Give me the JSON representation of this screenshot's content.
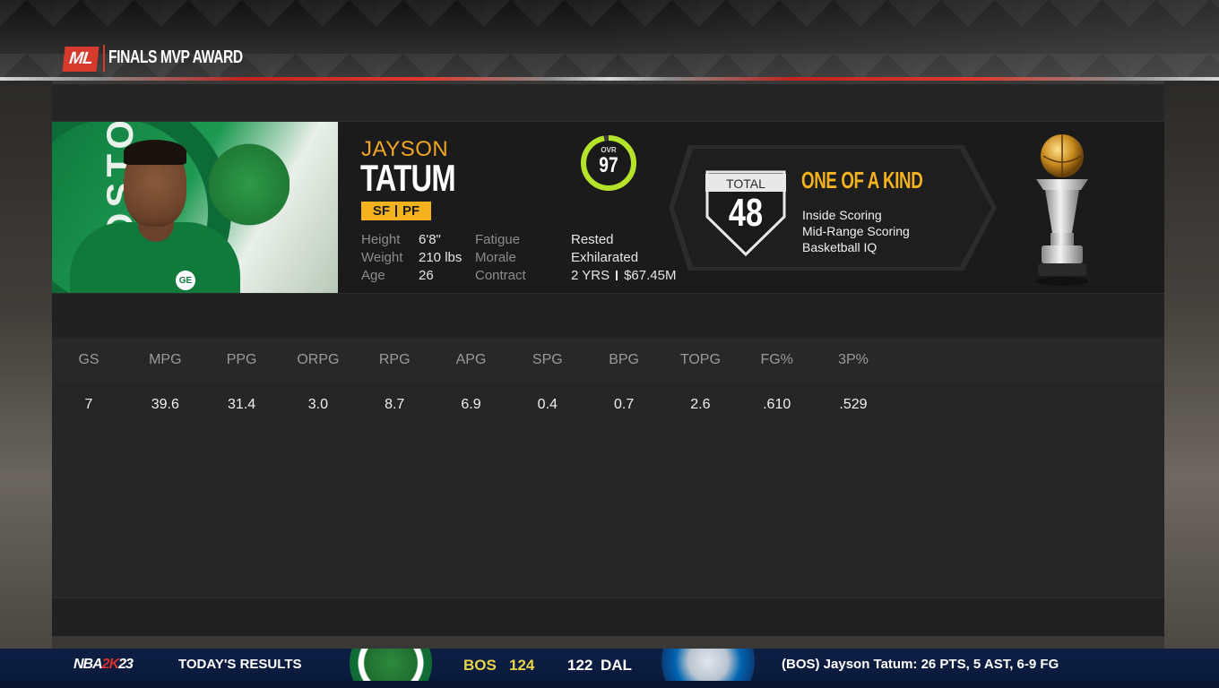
{
  "header": {
    "logo_text": "ML",
    "title": "FINALS MVP AWARD"
  },
  "player": {
    "first_name": "JAYSON",
    "last_name": "TATUM",
    "position_1": "SF",
    "position_2": "PF",
    "photo_text": "BOSTO",
    "photo_sponsor": "GE",
    "bio": {
      "height_label": "Height",
      "height": "6'8\"",
      "weight_label": "Weight",
      "weight": "210 lbs",
      "age_label": "Age",
      "age": "26",
      "fatigue_label": "Fatigue",
      "fatigue": "Rested",
      "morale_label": "Morale",
      "morale": "Exhilarated",
      "contract_label": "Contract",
      "contract_years": "2 YRS",
      "contract_value": "$67.45M"
    },
    "ovr_label": "OVR",
    "ovr": "97",
    "ovr_fraction": 0.97
  },
  "badge": {
    "total_label": "TOTAL",
    "total": "48",
    "title": "ONE OF A KIND",
    "items": [
      "Inside Scoring",
      "Mid-Range Scoring",
      "Basketball IQ"
    ]
  },
  "stats": {
    "headers": [
      "GS",
      "MPG",
      "PPG",
      "ORPG",
      "RPG",
      "APG",
      "SPG",
      "BPG",
      "TOPG",
      "FG%",
      "3P%"
    ],
    "values": [
      "7",
      "39.6",
      "31.4",
      "3.0",
      "8.7",
      "6.9",
      "0.4",
      "0.7",
      "2.6",
      ".610",
      ".529"
    ]
  },
  "ticker": {
    "brand_a": "NBA",
    "brand_b": "2K",
    "brand_c": "23",
    "label": "TODAY'S RESULTS",
    "home_team": "BOS",
    "home_score": "124",
    "away_score": "122",
    "away_team": "DAL",
    "news": "(BOS) Jayson Tatum: 26 PTS, 5 AST, 6-9 FG"
  },
  "colors": {
    "accent": "#f5b21f",
    "ovr_ring": "#b5e32a",
    "header_red": "#d63a2c",
    "ticker_bg": "#0f1f44"
  }
}
